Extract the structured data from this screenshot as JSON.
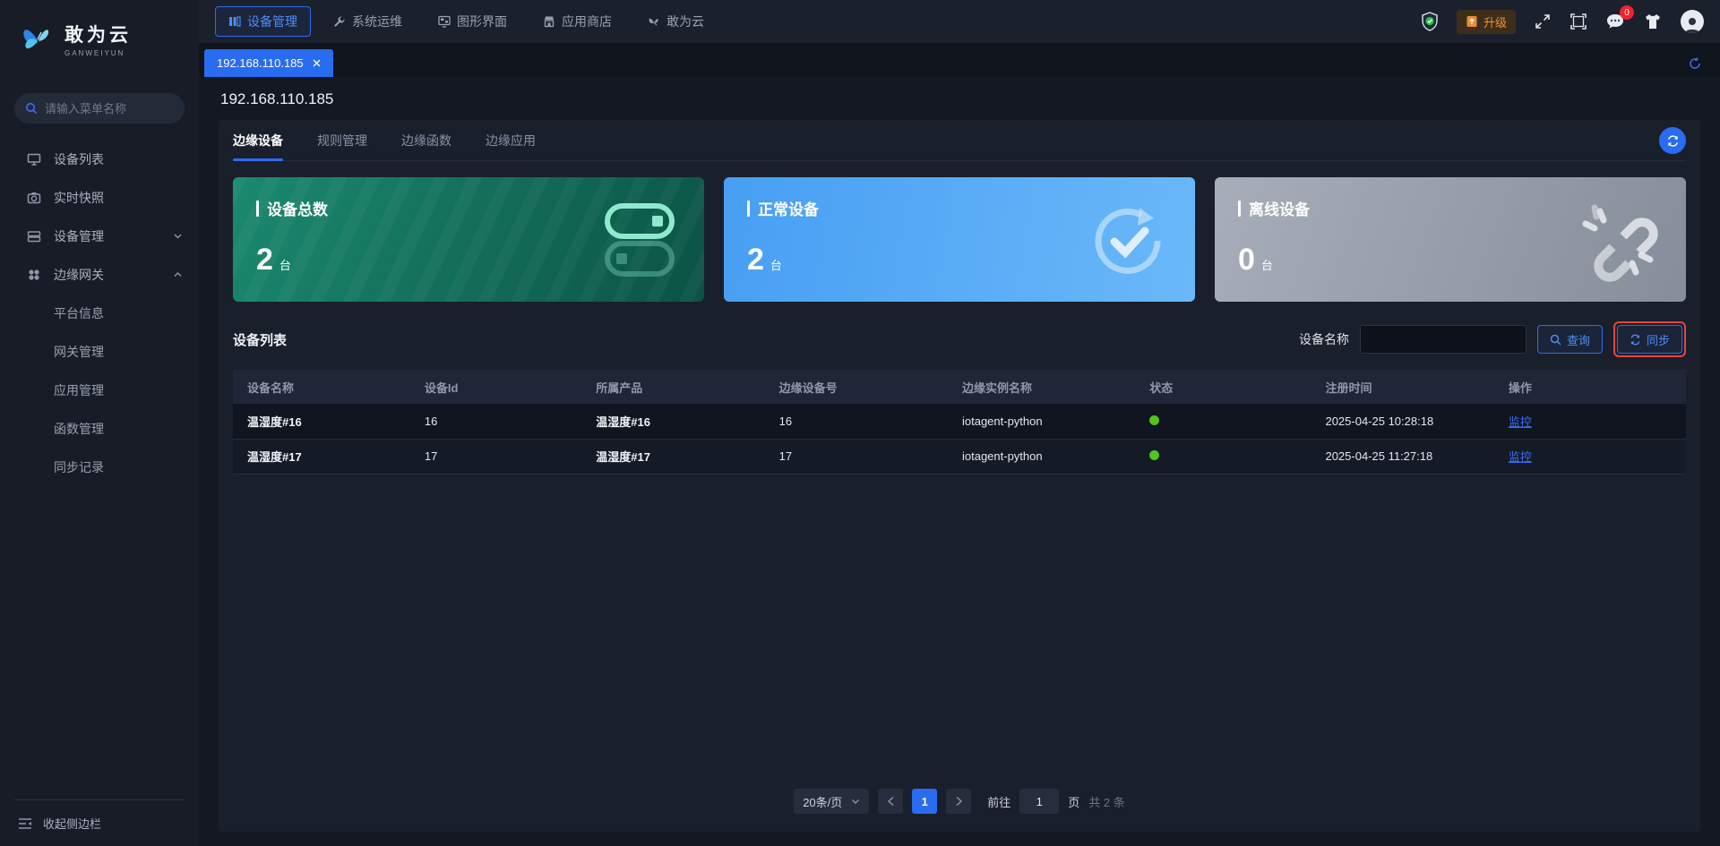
{
  "brand": {
    "name": "敢为云",
    "sub": "GANWEIYUN"
  },
  "topnav": {
    "items": [
      {
        "label": "设备管理",
        "active": true
      },
      {
        "label": "系统运维",
        "active": false
      },
      {
        "label": "图形界面",
        "active": false
      },
      {
        "label": "应用商店",
        "active": false
      },
      {
        "label": "敢为云",
        "active": false
      }
    ]
  },
  "topbar_right": {
    "upgrade_label": "升级",
    "message_badge": "0"
  },
  "tabbar": {
    "active_tab": "192.168.110.185"
  },
  "sidebar": {
    "search_placeholder": "请输入菜单名称",
    "items": [
      {
        "label": "设备列表"
      },
      {
        "label": "实时快照"
      },
      {
        "label": "设备管理",
        "expandable": true,
        "expanded": false
      },
      {
        "label": "边缘网关",
        "expandable": true,
        "expanded": true
      }
    ],
    "sub_items": [
      {
        "label": "平台信息"
      },
      {
        "label": "网关管理"
      },
      {
        "label": "应用管理"
      },
      {
        "label": "函数管理"
      },
      {
        "label": "同步记录"
      }
    ],
    "collapse_label": "收起侧边栏"
  },
  "main": {
    "title": "192.168.110.185",
    "tabs": [
      {
        "label": "边缘设备",
        "active": true
      },
      {
        "label": "规则管理",
        "active": false
      },
      {
        "label": "边缘函数",
        "active": false
      },
      {
        "label": "边缘应用",
        "active": false
      }
    ]
  },
  "stats": [
    {
      "label": "设备总数",
      "value": "2",
      "unit": "台"
    },
    {
      "label": "正常设备",
      "value": "2",
      "unit": "台"
    },
    {
      "label": "离线设备",
      "value": "0",
      "unit": "台"
    }
  ],
  "device_list": {
    "section_title": "设备列表",
    "filter_label": "设备名称",
    "filter_value": "",
    "search_button": "查询",
    "sync_button": "同步"
  },
  "table": {
    "headers": [
      "设备名称",
      "设备Id",
      "所属产品",
      "边缘设备号",
      "边缘实例名称",
      "状态",
      "注册时间",
      "操作"
    ],
    "rows": [
      {
        "name": "温湿度#16",
        "id": "16",
        "product": "温湿度#16",
        "edge_no": "16",
        "instance": "iotagent-python",
        "status": "online",
        "time": "2025-04-25 10:28:18",
        "action": "监控"
      },
      {
        "name": "温湿度#17",
        "id": "17",
        "product": "温湿度#17",
        "edge_no": "17",
        "instance": "iotagent-python",
        "status": "online",
        "time": "2025-04-25 11:27:18",
        "action": "监控"
      }
    ]
  },
  "pagination": {
    "page_size": "20条/页",
    "current_page": "1",
    "goto_label": "前往",
    "goto_value": "1",
    "page_unit": "页",
    "total_label": "共 2 条"
  },
  "colors": {
    "accent_blue": "#2a6cf0",
    "status_green": "#52c41a",
    "upgrade_orange": "#ef9135",
    "sync_highlight_red": "#e8453c",
    "card_green_start": "#1b8a6f",
    "card_blue_start": "#479ff3",
    "card_gray_start": "#a7aeb9"
  }
}
